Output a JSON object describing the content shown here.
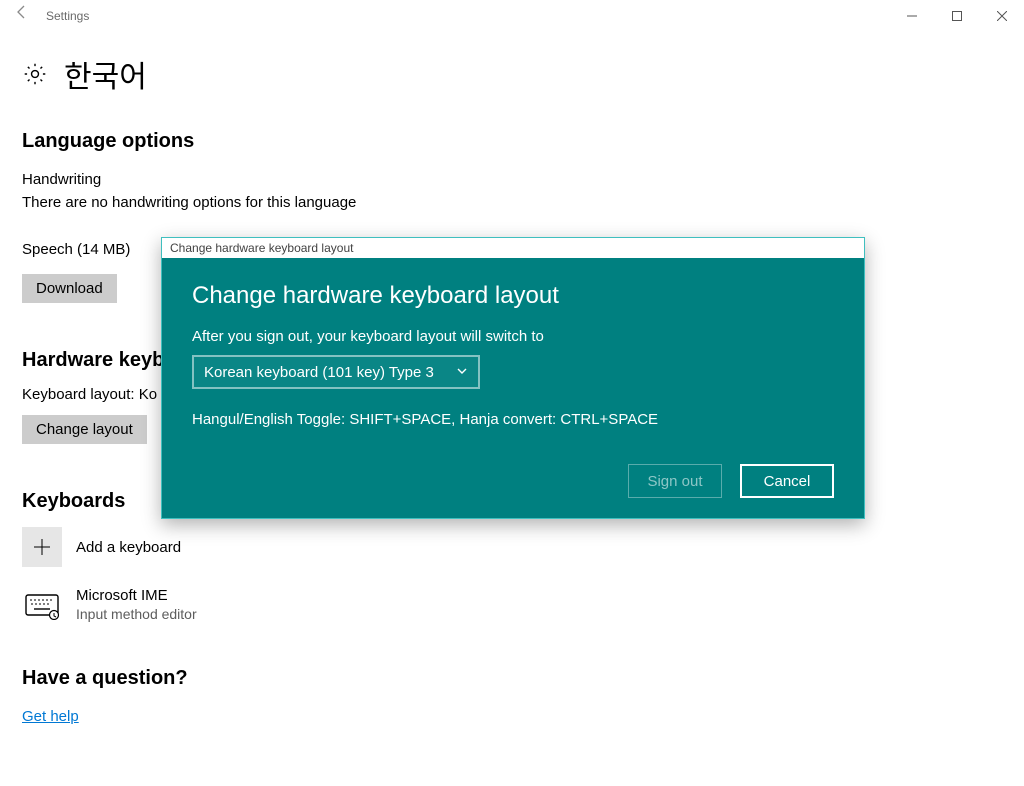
{
  "window": {
    "app_title": "Settings"
  },
  "page": {
    "title": "한국어"
  },
  "sections": {
    "language_options": {
      "heading": "Language options",
      "handwriting_label": "Handwriting",
      "handwriting_note": "There are no handwriting options for this language",
      "speech_label": "Speech (14 MB)",
      "download_btn": "Download"
    },
    "hardware": {
      "heading": "Hardware keyboard layout",
      "layout_label_prefix": "Keyboard layout:  Ko",
      "change_btn": "Change layout"
    },
    "keyboards": {
      "heading": "Keyboards",
      "add_label": "Add a keyboard",
      "ime_name": "Microsoft IME",
      "ime_desc": "Input method editor"
    },
    "question": {
      "heading": "Have a question?",
      "link": "Get help"
    }
  },
  "dialog": {
    "titlebar": "Change hardware keyboard layout",
    "heading": "Change hardware keyboard layout",
    "after_text": "After you sign out, your keyboard layout will switch to",
    "selected_option": "Korean keyboard (101 key) Type 3",
    "info_text": "Hangul/English Toggle: SHIFT+SPACE, Hanja convert: CTRL+SPACE",
    "signout_btn": "Sign out",
    "cancel_btn": "Cancel"
  }
}
